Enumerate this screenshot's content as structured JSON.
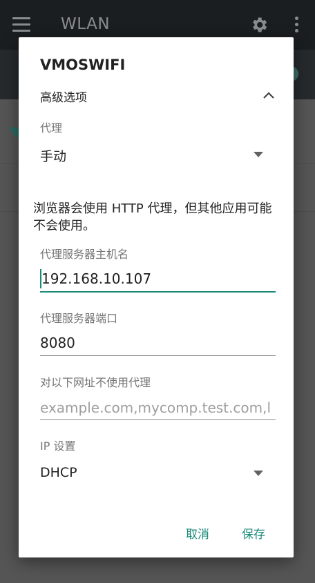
{
  "appbar": {
    "title": "WLAN",
    "menu_icon": "menu-icon",
    "settings_icon": "gear-icon",
    "more_icon": "more-vert-icon"
  },
  "dialog": {
    "title": "VMOSWIFI",
    "advanced_label": "高级选项",
    "proxy": {
      "label": "代理",
      "value": "手动"
    },
    "warning": "浏览器会使用 HTTP 代理，但其他应用可能不会使用。",
    "hostname": {
      "label": "代理服务器主机名",
      "value": "192.168.10.107"
    },
    "port": {
      "label": "代理服务器端口",
      "value": "8080"
    },
    "bypass": {
      "label": "对以下网址不使用代理",
      "placeholder": "example.com,mycomp.test.com,l"
    },
    "ip": {
      "label": "IP 设置",
      "value": "DHCP"
    },
    "cancel_label": "取消",
    "save_label": "保存"
  },
  "colors": {
    "accent": "#1b8a7a",
    "scrim": "#5a5a5a"
  }
}
